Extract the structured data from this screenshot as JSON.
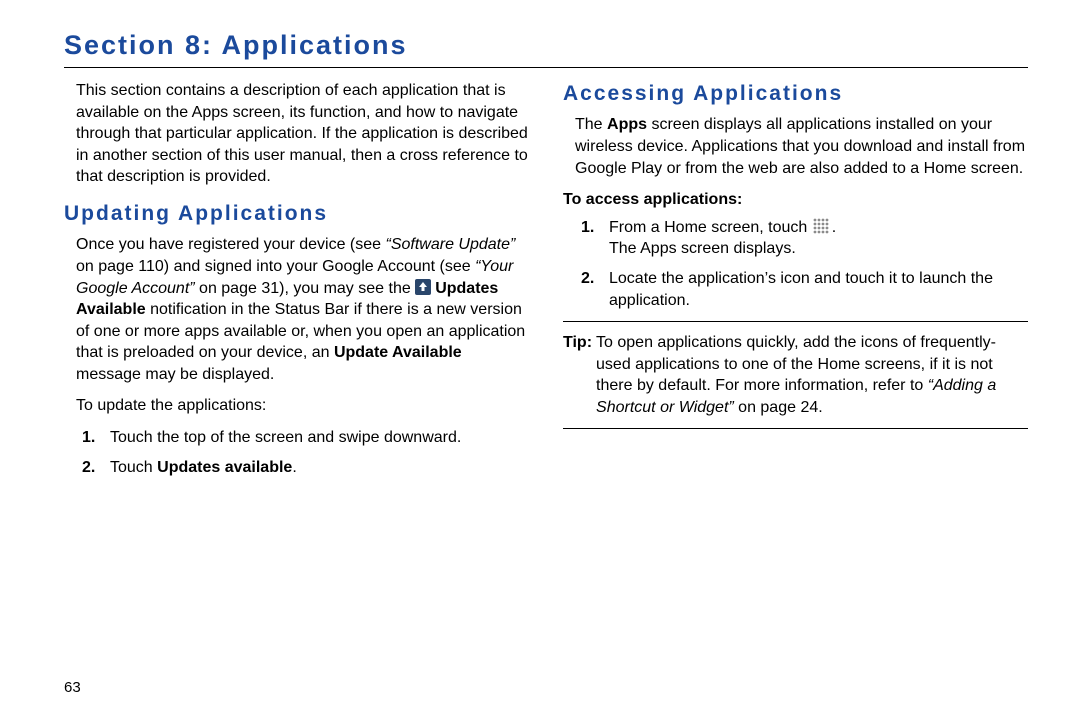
{
  "section_title": "Section 8: Applications",
  "page_number": "63",
  "left": {
    "intro": "This section contains a description of each application that is available on the Apps screen, its function, and how to navigate through that particular application. If the application is described in another section of this user manual, then a cross reference to that description is provided.",
    "updating_heading": "Updating Applications",
    "updating_para": {
      "p1": "Once you have registered your device (see ",
      "ref1": "“Software Update”",
      "p2": " on page 110) and signed into your Google Account (see ",
      "ref2": "“Your Google Account”",
      "p3": " on page 31), you may see the ",
      "bold1": "Updates Available",
      "p4": " notification in the Status Bar if there is a new version of one or more apps available or, when you open an application that is preloaded on your device, an ",
      "bold2": "Update Available",
      "p5": " message may be displayed."
    },
    "to_update_label": "To update the applications:",
    "steps": {
      "s1_num": "1.",
      "s1_text": "Touch the top of the screen and swipe downward.",
      "s2_num": "2.",
      "s2_pre": "Touch ",
      "s2_bold": "Updates available",
      "s2_post": "."
    }
  },
  "right": {
    "accessing_heading": "Accessing Applications",
    "accessing_para": {
      "p1": "The ",
      "bold1": "Apps",
      "p2": " screen displays all applications installed on your wireless device. Applications that you download and install from Google Play or from the web are also added to a Home screen."
    },
    "to_access_label": "To access applications:",
    "steps": {
      "s1_num": "1.",
      "s1_pre": "From a Home screen, touch ",
      "s1_icon_name": "apps-grid-icon",
      "s1_post": ".",
      "s1_line2": "The Apps screen displays.",
      "s2_num": "2.",
      "s2_text": "Locate the application’s icon and touch it to launch the application."
    },
    "tip": {
      "label": "Tip:",
      "body_pre": " To open applications quickly, add the icons of frequently-used applications to one of the Home screens, if it is not there by default. For more information, refer to ",
      "ref": "“Adding a Shortcut or Widget”",
      "body_post": " on page 24."
    }
  }
}
